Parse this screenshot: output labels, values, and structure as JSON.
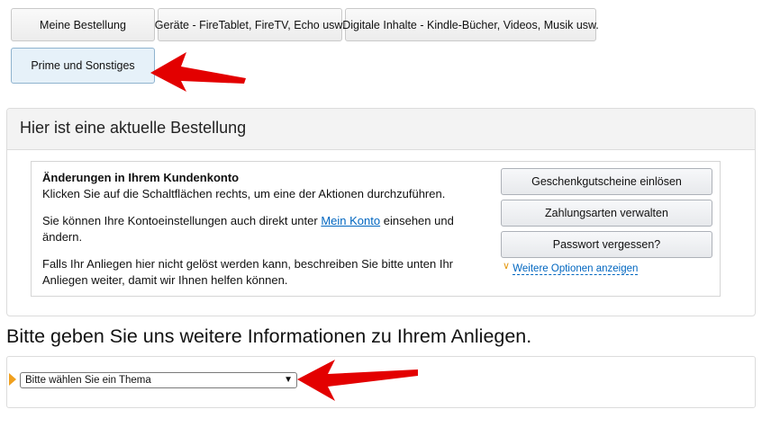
{
  "tabs": [
    {
      "label": "Meine Bestellung"
    },
    {
      "label": "Geräte - FireTablet, FireTV, Echo usw."
    },
    {
      "label": "Digitale Inhalte - Kindle-Bücher, Videos, Musik usw."
    },
    {
      "label": "Prime und Sonstiges",
      "active": true
    }
  ],
  "order_panel": {
    "title": "Hier ist eine aktuelle Bestellung",
    "account_changes": {
      "heading": "Änderungen in Ihrem Kundenkonto",
      "line1": "Klicken Sie auf die Schaltflächen rechts, um eine der Aktionen durchzuführen.",
      "para2_before": "Sie können Ihre Kontoeinstellungen auch direkt unter",
      "para2_link": "Mein Konto",
      "para2_after": "einsehen und",
      "para2_line2": "ändern.",
      "para3_line1": "Falls Ihr Anliegen hier nicht gelöst werden kann, beschreiben Sie bitte unten Ihr",
      "para3_line2": "Anliegen weiter, damit wir Ihnen helfen können."
    },
    "buttons": [
      {
        "label": "Geschenkgutscheine einlösen"
      },
      {
        "label": "Zahlungsarten verwalten"
      },
      {
        "label": "Passwort vergessen?"
      }
    ],
    "more_options": "Weitere Optionen anzeigen"
  },
  "info_section": {
    "heading": "Bitte geben Sie uns weitere Informationen zu Ihrem Anliegen.",
    "topic_select": {
      "selected": "Bitte wählen Sie ein Thema"
    }
  },
  "colors": {
    "annotation_arrow": "#e30000",
    "link": "#0066c0",
    "step_marker": "#f0a01e"
  }
}
